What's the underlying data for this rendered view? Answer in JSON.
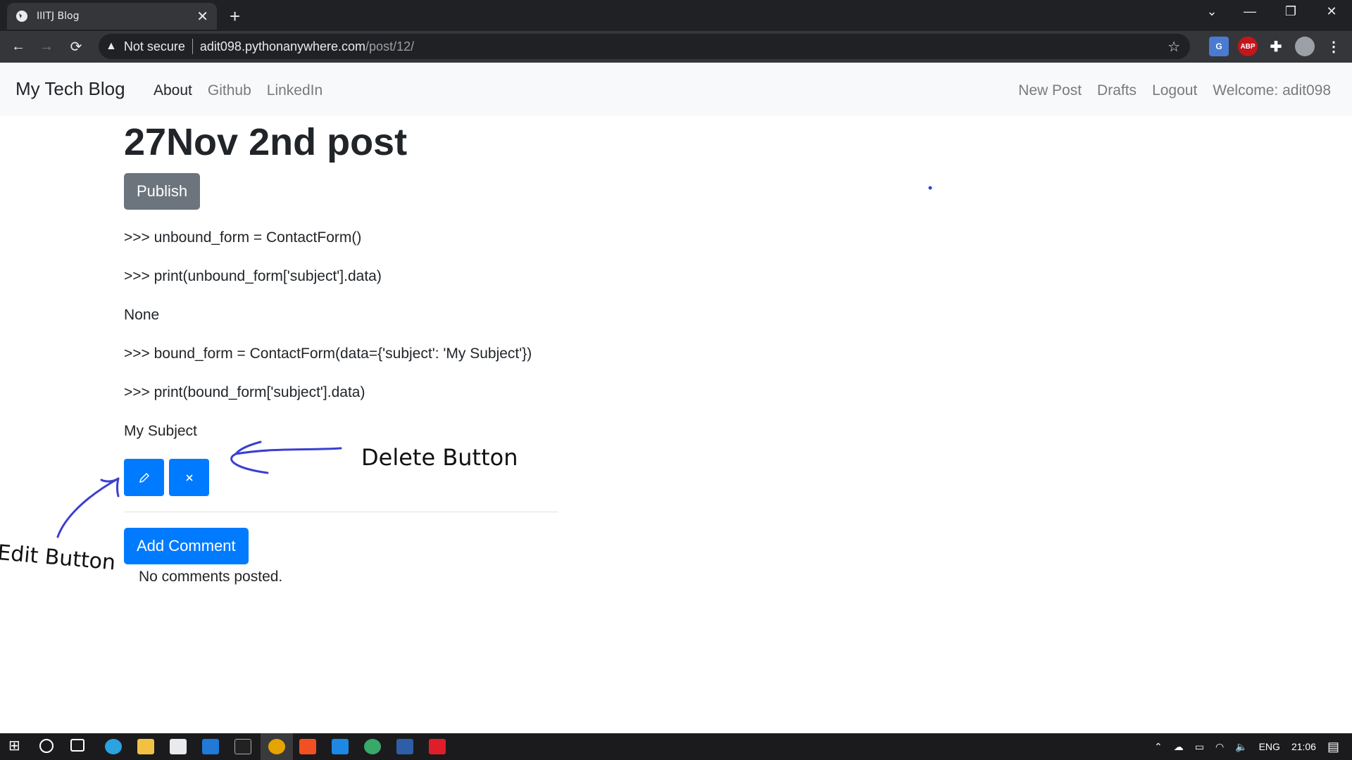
{
  "browser": {
    "tab_title": "IIITJ Blog",
    "security_label": "Not secure",
    "url_host": "adit098.pythonanywhere.com",
    "url_path": "/post/12/",
    "ext_abp": "ABP"
  },
  "navbar": {
    "brand": "My Tech Blog",
    "left_links": [
      "About",
      "Github",
      "LinkedIn"
    ],
    "right_links": [
      "New Post",
      "Drafts",
      "Logout",
      "Welcome: adit098"
    ]
  },
  "post": {
    "title": "27Nov 2nd post",
    "publish_label": "Publish",
    "paragraphs": [
      ">>> unbound_form = ContactForm()",
      ">>> print(unbound_form['subject'].data)",
      "None",
      ">>> bound_form = ContactForm(data={'subject': 'My Subject'})",
      ">>> print(bound_form['subject'].data)",
      "My Subject"
    ],
    "add_comment_label": "Add Comment",
    "no_comments": "No comments posted."
  },
  "annotations": {
    "delete_label": "Delete Button",
    "edit_label": "Edit Button"
  },
  "taskbar": {
    "lang": "ENG",
    "time": "21:06"
  },
  "colors": {
    "primary": "#007bff",
    "secondary": "#6c757d",
    "annotation_ink": "#3b3fd0"
  }
}
